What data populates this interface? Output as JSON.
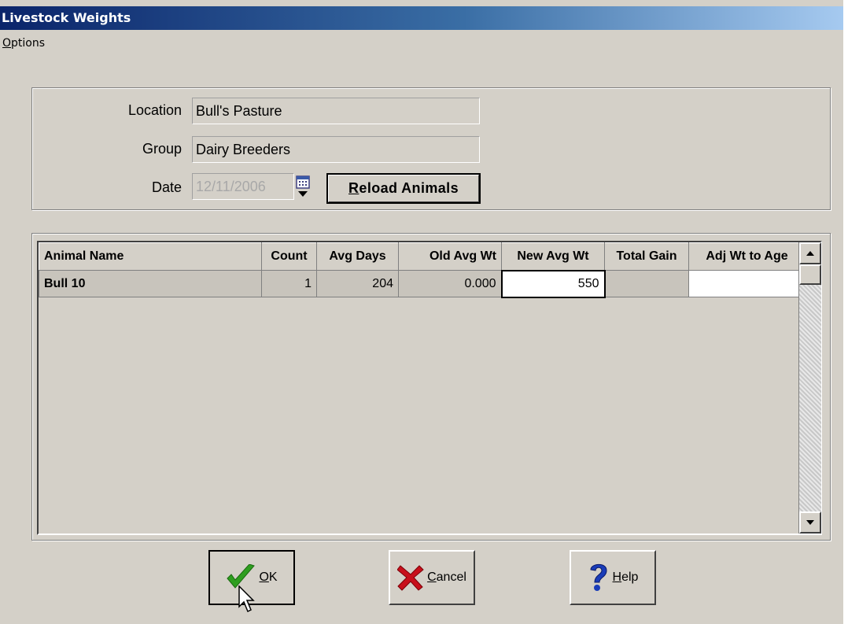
{
  "window": {
    "title": "Livestock Weights"
  },
  "menu": {
    "items": [
      {
        "label_mn": "O",
        "label_rest": "ptions"
      }
    ]
  },
  "form": {
    "location_label": "Location",
    "location_value": "Bull's Pasture",
    "group_label": "Group",
    "group_value": "Dairy Breeders",
    "date_label": "Date",
    "date_value": "12/11/2006",
    "reload_mn": "R",
    "reload_rest": "eload Animals"
  },
  "grid": {
    "columns": [
      "Animal Name",
      "Count",
      "Avg Days",
      "Old Avg Wt",
      "New Avg Wt",
      "Total Gain",
      "Adj Wt to Age"
    ],
    "rows": [
      {
        "animal_name": "Bull 10",
        "count": "1",
        "avg_days": "204",
        "old_avg_wt": "0.000",
        "new_avg_wt": "550",
        "total_gain": "",
        "adj_wt_to_age": ""
      }
    ]
  },
  "buttons": {
    "ok_mn": "O",
    "ok_rest": "K",
    "cancel_mn": "C",
    "cancel_rest": "ancel",
    "help_mn": "H",
    "help_rest": "elp"
  },
  "icons": {
    "calendar": "calendar-icon",
    "ok": "checkmark-icon",
    "cancel": "x-icon",
    "help": "question-icon",
    "scroll_up": "arrow-up-icon",
    "scroll_down": "arrow-down-icon",
    "cursor": "mouse-pointer-icon"
  },
  "colors": {
    "title_start": "#0a246a",
    "title_end": "#a6caf0",
    "face": "#d4d0c8",
    "ok_green": "#2e9e1f",
    "cancel_red": "#c8101c",
    "help_blue": "#1a3cb8"
  }
}
